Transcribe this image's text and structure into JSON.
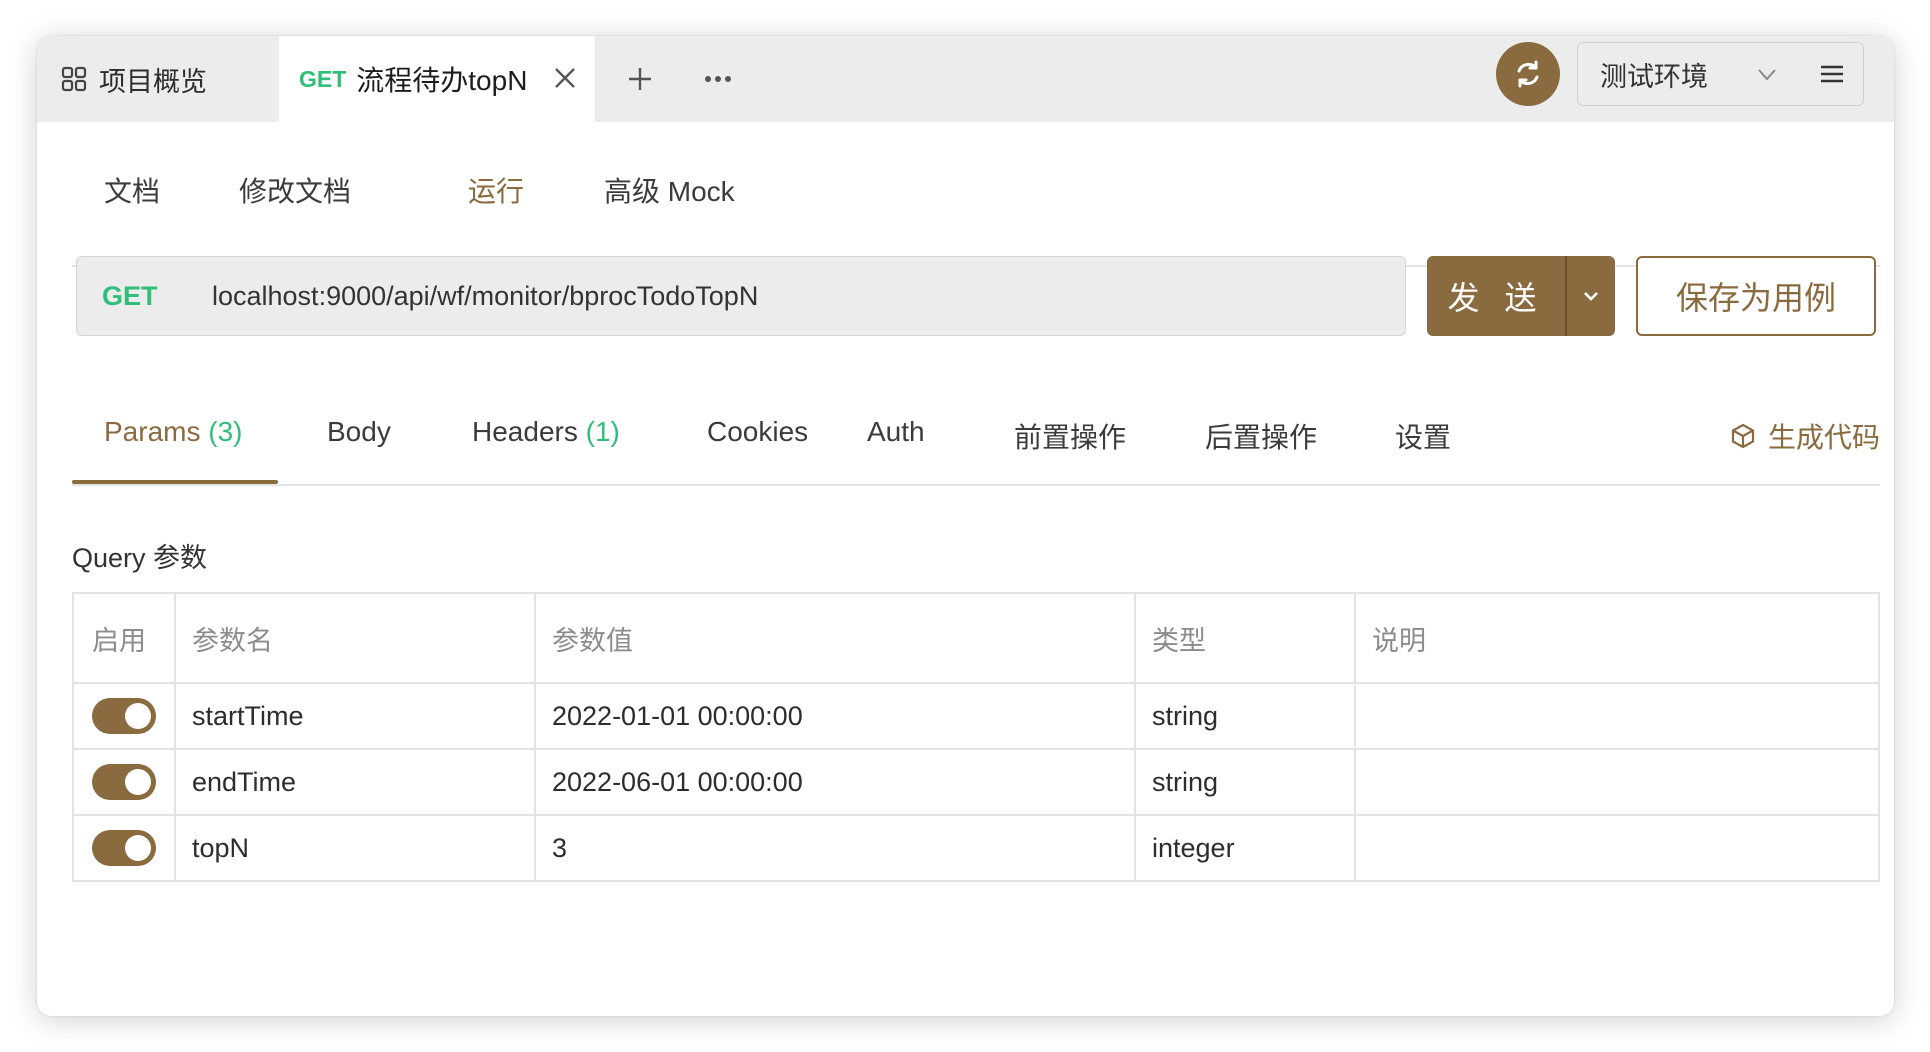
{
  "colors": {
    "accent": "#8a6a3f",
    "method_get": "#2fbf78",
    "tabbar_bg": "#ececec",
    "border": "#e3e3e3"
  },
  "tabbar": {
    "overview_label": "项目概览",
    "overview_icon": "grid-icon",
    "active_tab": {
      "method": "GET",
      "name": "流程待办topN"
    },
    "add_tab_icon": "plus-icon",
    "more_icon": "ellipsis-icon",
    "sync_icon": "sync-icon",
    "environment": "测试环境",
    "menu_icon": "hamburger-menu-icon"
  },
  "subtabs": {
    "items": [
      "文档",
      "修改文档",
      "运行",
      "高级 Mock"
    ],
    "active": "运行"
  },
  "request": {
    "method": "GET",
    "url": "localhost:9000/api/wf/monitor/bprocTodoTopN",
    "send_label": "发 送",
    "save_case_label": "保存为用例"
  },
  "reqtabs": {
    "params": "Params",
    "params_count": "(3)",
    "body": "Body",
    "headers": "Headers",
    "headers_count": "(1)",
    "cookies": "Cookies",
    "auth": "Auth",
    "pre_ops": "前置操作",
    "post_ops": "后置操作",
    "settings": "设置",
    "gen_code": "生成代码",
    "active": "Params"
  },
  "query": {
    "title": "Query 参数",
    "columns": [
      "启用",
      "参数名",
      "参数值",
      "类型",
      "说明"
    ],
    "rows": [
      {
        "enabled": true,
        "name": "startTime",
        "value": "2022-01-01 00:00:00",
        "type": "string",
        "desc": ""
      },
      {
        "enabled": true,
        "name": "endTime",
        "value": "2022-06-01 00:00:00",
        "type": "string",
        "desc": ""
      },
      {
        "enabled": true,
        "name": "topN",
        "value": "3",
        "type": "integer",
        "desc": ""
      }
    ]
  }
}
